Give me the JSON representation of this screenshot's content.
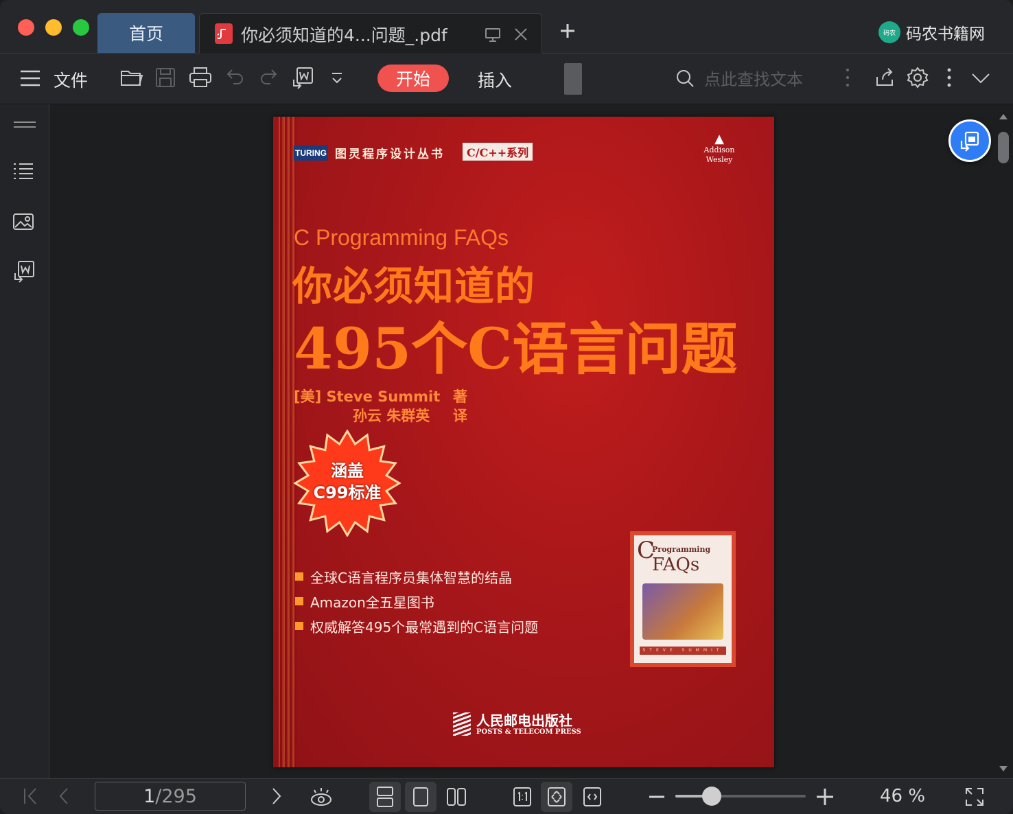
{
  "tabs": {
    "home_label": "首页",
    "doc_title": "你必须知道的4...问题_.pdf"
  },
  "brand": {
    "logo_text": "码农",
    "name": "码农书籍网"
  },
  "toolbar": {
    "file_label": "文件",
    "start_label": "开始",
    "insert_label": "插入",
    "search_placeholder": "点此查找文本"
  },
  "cover": {
    "publisher_brand": "TURING",
    "series_zh": "图灵程序设计丛书",
    "series_tag": "C/C++系列",
    "aw_line1": "Addison",
    "aw_line2": "Wesley",
    "english_title": "C Programming FAQs",
    "title_line1": "你必须知道的",
    "title_line2": "495个C语言问题",
    "author_line": "[美] Steve Summit",
    "author_role": "著",
    "translators": "孙云 朱群英",
    "translator_role": "译",
    "burst_line1": "涵盖",
    "burst_line2": "C99标准",
    "bullets": [
      "全球C语言程序员集体智慧的结晶",
      "Amazon全五星图书",
      "权威解答495个最常遇到的C语言问题"
    ],
    "mini_c": "C",
    "mini_programming": "Programming",
    "mini_faqs": "FAQs",
    "mini_author": "STEVE SUMMIT",
    "press_zh": "人民邮电出版社",
    "press_en": "POSTS & TELECOM PRESS"
  },
  "status": {
    "current_page": "1",
    "total_pages": "/295",
    "zoom_label": "46 %",
    "zoom_fraction": 0.28
  },
  "colors": {
    "accent": "#f0524f",
    "tab_active": "#3b5a80",
    "float_button": "#2f7df6"
  }
}
